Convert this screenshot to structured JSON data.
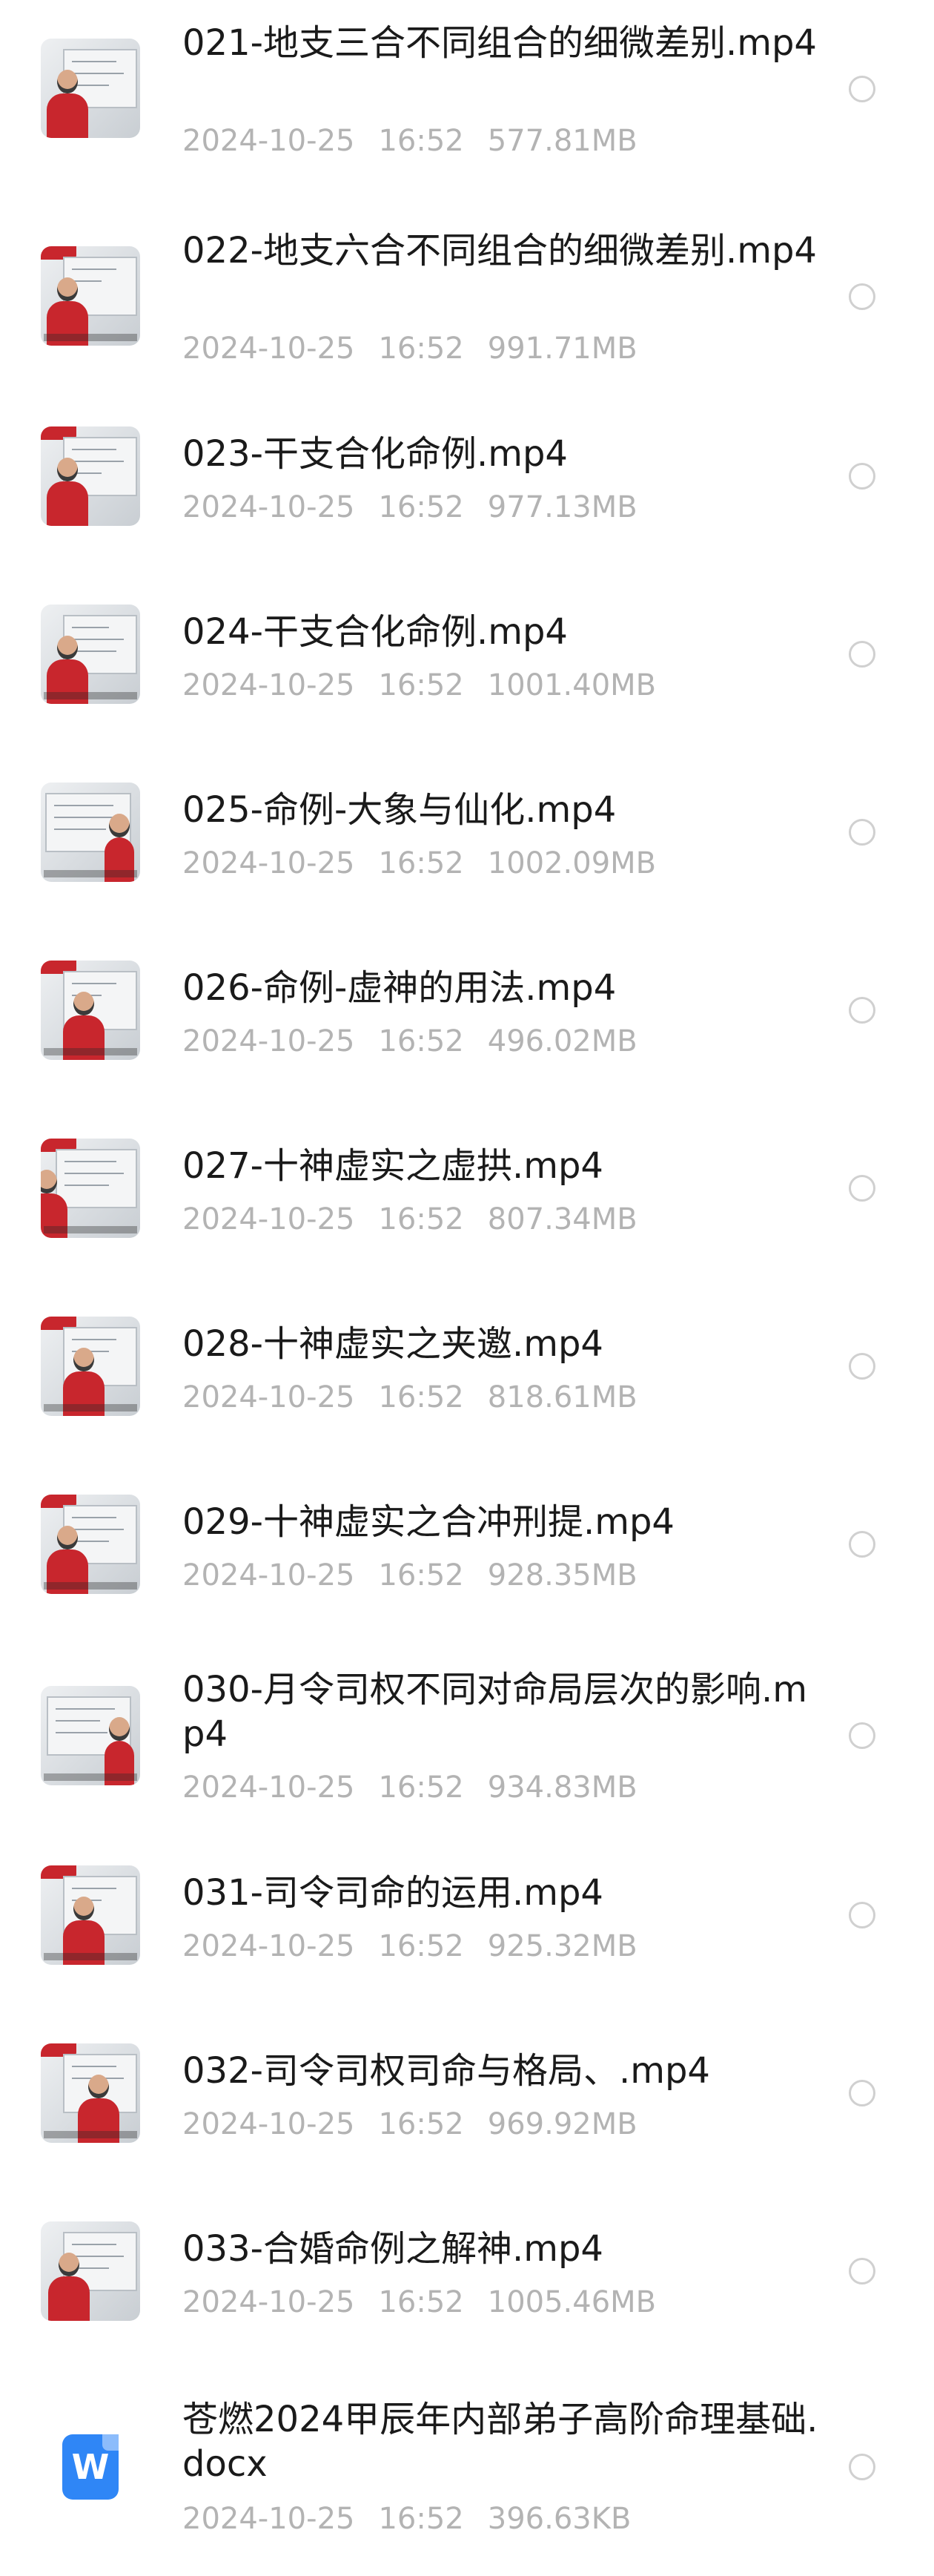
{
  "files": [
    {
      "name": "021-地支三合不同组合的细微差别.mp4",
      "date": "2024-10-25",
      "time": "16:52",
      "size": "577.81MB",
      "type": "video",
      "thumbnail": "video-thumbnail"
    },
    {
      "name": "022-地支六合不同组合的细微差别.mp4",
      "date": "2024-10-25",
      "time": "16:52",
      "size": "991.71MB",
      "type": "video",
      "thumbnail": "video-thumbnail"
    },
    {
      "name": "023-干支合化命例.mp4",
      "date": "2024-10-25",
      "time": "16:52",
      "size": "977.13MB",
      "type": "video",
      "thumbnail": "video-thumbnail"
    },
    {
      "name": "024-干支合化命例.mp4",
      "date": "2024-10-25",
      "time": "16:52",
      "size": "1001.40MB",
      "type": "video",
      "thumbnail": "video-thumbnail"
    },
    {
      "name": "025-命例-大象与仙化.mp4",
      "date": "2024-10-25",
      "time": "16:52",
      "size": "1002.09MB",
      "type": "video",
      "thumbnail": "video-thumbnail"
    },
    {
      "name": "026-命例-虚神的用法.mp4",
      "date": "2024-10-25",
      "time": "16:52",
      "size": "496.02MB",
      "type": "video",
      "thumbnail": "video-thumbnail"
    },
    {
      "name": "027-十神虚实之虚拱.mp4",
      "date": "2024-10-25",
      "time": "16:52",
      "size": "807.34MB",
      "type": "video",
      "thumbnail": "video-thumbnail"
    },
    {
      "name": "028-十神虚实之夹邀.mp4",
      "date": "2024-10-25",
      "time": "16:52",
      "size": "818.61MB",
      "type": "video",
      "thumbnail": "video-thumbnail"
    },
    {
      "name": "029-十神虚实之合冲刑提.mp4",
      "date": "2024-10-25",
      "time": "16:52",
      "size": "928.35MB",
      "type": "video",
      "thumbnail": "video-thumbnail"
    },
    {
      "name": "030-月令司权不同对命局层次的影响.mp4",
      "date": "2024-10-25",
      "time": "16:52",
      "size": "934.83MB",
      "type": "video",
      "thumbnail": "video-thumbnail"
    },
    {
      "name": "031-司令司命的运用.mp4",
      "date": "2024-10-25",
      "time": "16:52",
      "size": "925.32MB",
      "type": "video",
      "thumbnail": "video-thumbnail"
    },
    {
      "name": "032-司令司权司命与格局、.mp4",
      "date": "2024-10-25",
      "time": "16:52",
      "size": "969.92MB",
      "type": "video",
      "thumbnail": "video-thumbnail"
    },
    {
      "name": "033-合婚命例之解神.mp4",
      "date": "2024-10-25",
      "time": "16:52",
      "size": "1005.46MB",
      "type": "video",
      "thumbnail": "video-thumbnail"
    },
    {
      "name": "苍燃2024甲辰年内部弟子高阶命理基础.docx",
      "date": "2024-10-25",
      "time": "16:52",
      "size": "396.63KB",
      "type": "docx",
      "icon": "word-doc-icon",
      "icon_letter": "W",
      "icon_color": "#2f86f6"
    }
  ],
  "colors": {
    "title": "#1a1a1a",
    "meta": "#b3b3b3",
    "checkbox_border": "#d0d0d0",
    "thumb_accent": "#c8262d"
  }
}
